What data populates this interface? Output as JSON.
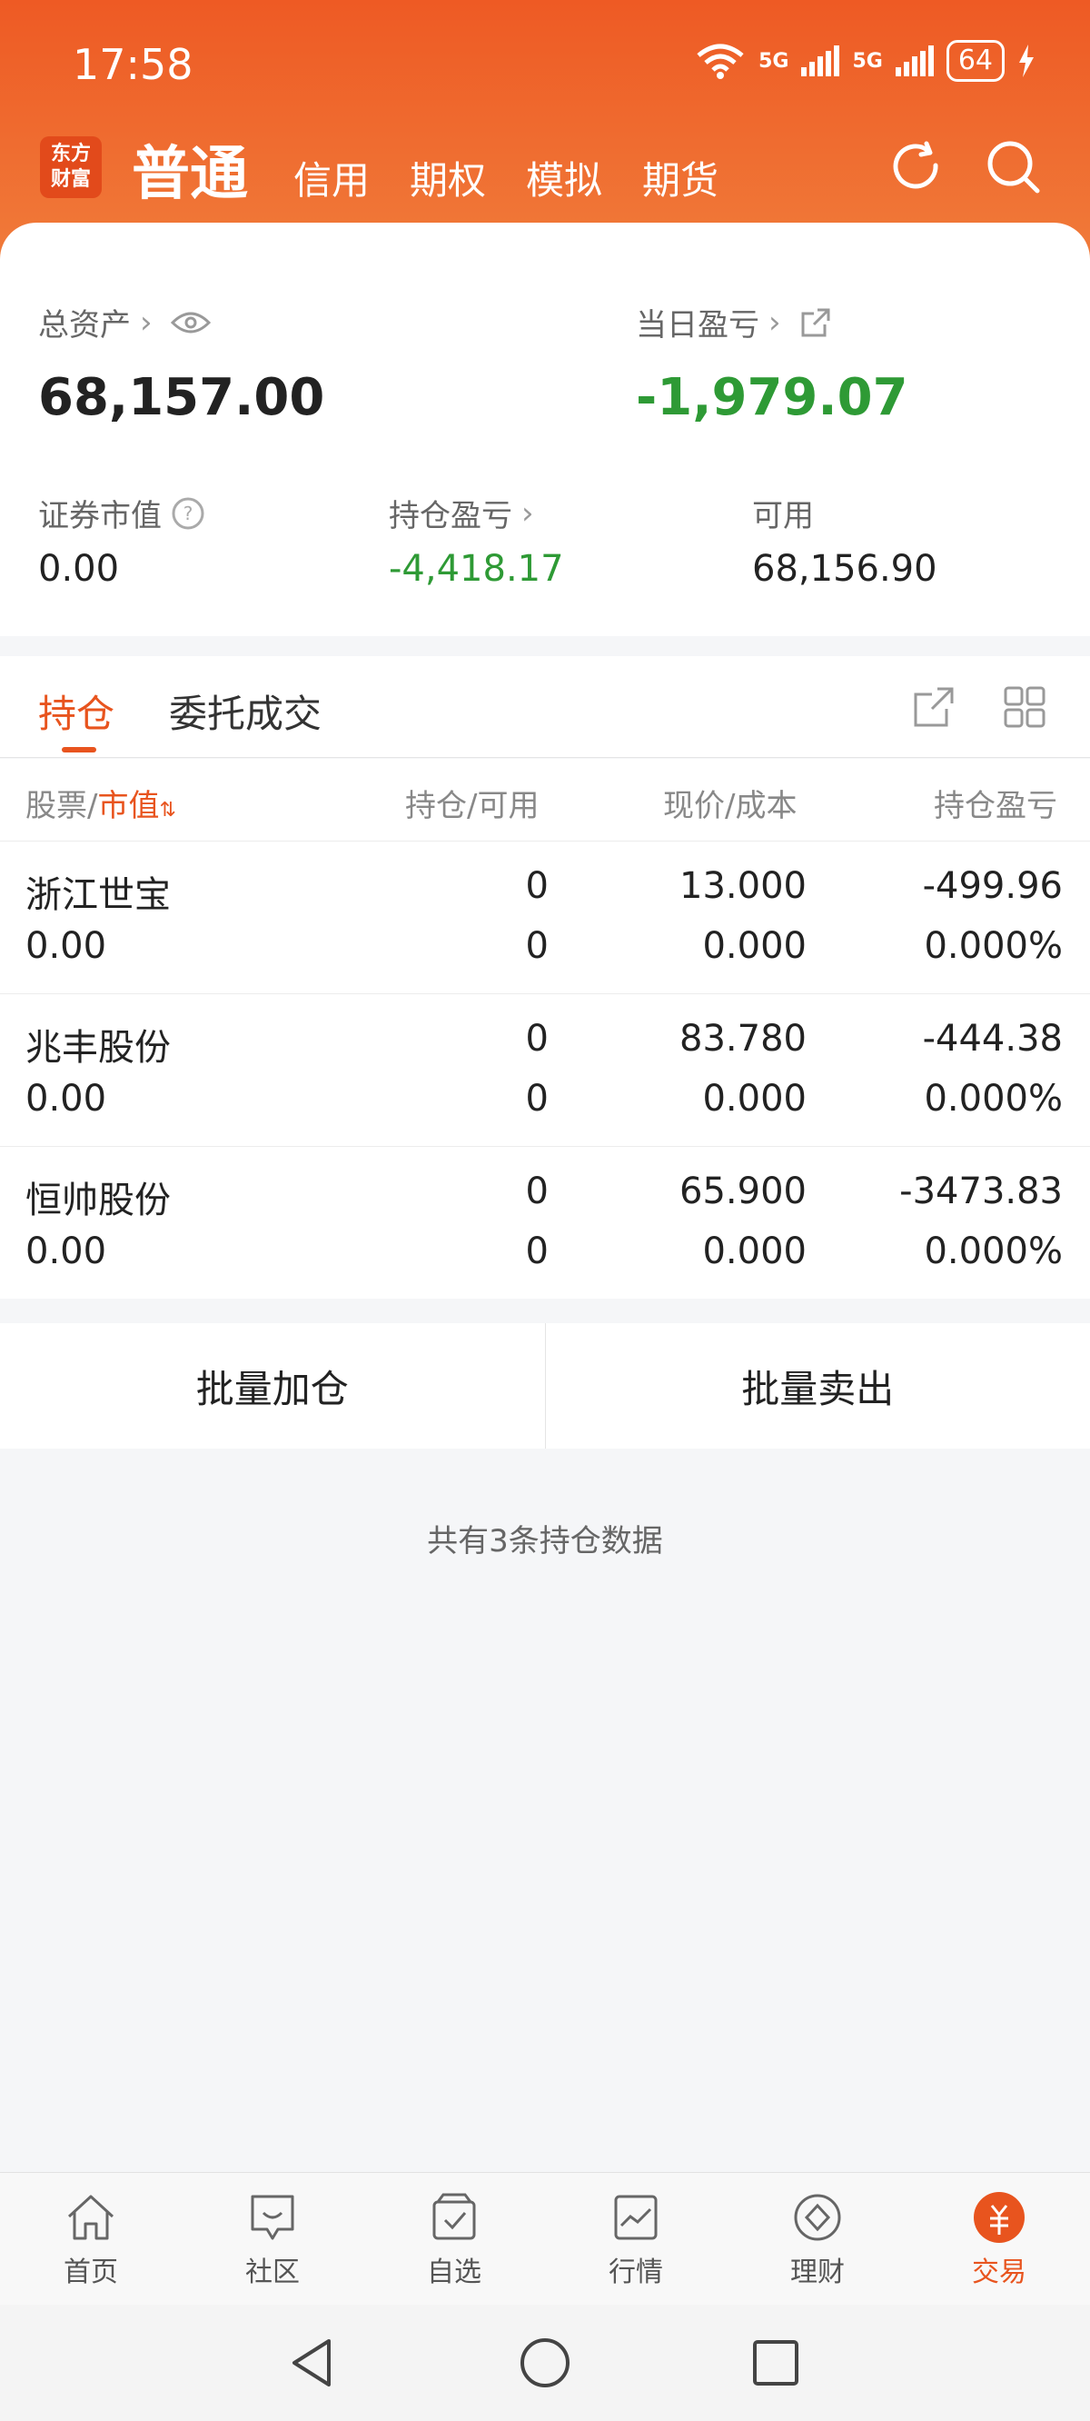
{
  "status": {
    "time": "17:58",
    "network": [
      "5G",
      "5G"
    ],
    "battery": "64"
  },
  "header": {
    "logo_text": [
      "东方",
      "财富"
    ],
    "tabs": [
      "普通",
      "信用",
      "期权",
      "模拟",
      "期货"
    ],
    "icons": [
      "refresh-icon",
      "search-icon"
    ]
  },
  "summary": {
    "total_assets_label": "总资产",
    "total_assets_value": "68,157.00",
    "daily_pnl_label": "当日盈亏",
    "daily_pnl_value": "-1,979.07",
    "market_value_label": "证券市值",
    "market_value_value": "0.00",
    "position_pnl_label": "持仓盈亏",
    "position_pnl_value": "-4,418.17",
    "available_label": "可用",
    "available_value": "68,156.90"
  },
  "tabs": {
    "positions": "持仓",
    "orders": "委托成交"
  },
  "table": {
    "headers": {
      "stock": "股票/",
      "market_value": "市值",
      "qty": "持仓/可用",
      "price": "现价/成本",
      "pnl": "持仓盈亏"
    },
    "rows": [
      {
        "name": "浙江世宝",
        "market_value": "0.00",
        "qty": "0",
        "available": "0",
        "price": "13.000",
        "cost": "0.000",
        "pnl": "-499.96",
        "pnl_pct": "0.000%"
      },
      {
        "name": "兆丰股份",
        "market_value": "0.00",
        "qty": "0",
        "available": "0",
        "price": "83.780",
        "cost": "0.000",
        "pnl": "-444.38",
        "pnl_pct": "0.000%"
      },
      {
        "name": "恒帅股份",
        "market_value": "0.00",
        "qty": "0",
        "available": "0",
        "price": "65.900",
        "cost": "0.000",
        "pnl": "-3473.83",
        "pnl_pct": "0.000%"
      }
    ]
  },
  "actions": {
    "batch_add": "批量加仓",
    "batch_sell": "批量卖出"
  },
  "footer_note": "共有3条持仓数据",
  "bottom_nav": [
    {
      "label": "首页",
      "icon": "home-icon"
    },
    {
      "label": "社区",
      "icon": "community-icon"
    },
    {
      "label": "自选",
      "icon": "watchlist-icon"
    },
    {
      "label": "行情",
      "icon": "market-icon"
    },
    {
      "label": "理财",
      "icon": "wealth-icon"
    },
    {
      "label": "交易",
      "icon": "trade-icon"
    }
  ],
  "colors": {
    "accent": "#e8541e",
    "loss": "#2e9a35"
  }
}
